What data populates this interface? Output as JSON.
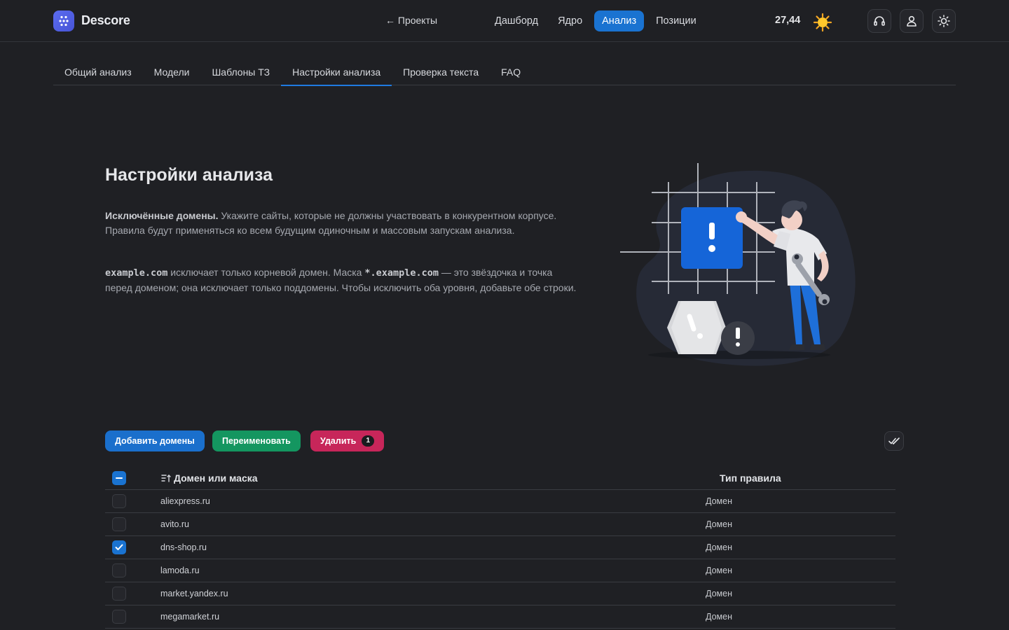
{
  "app": {
    "name": "Descore"
  },
  "header": {
    "back_label": "← Проекты",
    "nav": [
      {
        "label": "Дашборд",
        "active": false
      },
      {
        "label": "Ядро",
        "active": false
      },
      {
        "label": "Анализ",
        "active": true
      },
      {
        "label": "Позиции",
        "active": false
      }
    ],
    "balance": "27,44",
    "icons": [
      "sun-emoji-icon",
      "headset-icon",
      "user-icon",
      "theme-toggle-icon"
    ]
  },
  "subtabs": [
    {
      "label": "Общий анализ",
      "active": false
    },
    {
      "label": "Модели",
      "active": false
    },
    {
      "label": "Шаблоны ТЗ",
      "active": false
    },
    {
      "label": "Настройки анализа",
      "active": true
    },
    {
      "label": "Проверка текста",
      "active": false
    },
    {
      "label": "FAQ",
      "active": false
    }
  ],
  "intro": {
    "title": "Настройки анализа",
    "p1_strong": "Исключённые домены.",
    "p1_text": " Укажите сайты, которые не должны участвовать в конкурентном корпусе. Правила будут применяться ко всем будущим одиночным и массовым запускам анализа.",
    "p2_code1": "example.com",
    "p2_text1": " исключает только корневой домен. Маска ",
    "p2_code2": "*.example.com",
    "p2_text2": " — это звёздочка и точка перед доменом; она исключает только поддомены. Чтобы исключить оба уровня, добавьте обе строки."
  },
  "actions": {
    "add_label": "Добавить домены",
    "rename_label": "Переименовать",
    "delete_label": "Удалить",
    "delete_count": "1"
  },
  "table": {
    "col_domain": "Домен или маска",
    "col_type": "Тип правила",
    "rows": [
      {
        "domain": "aliexpress.ru",
        "type": "Домен",
        "checked": false
      },
      {
        "domain": "avito.ru",
        "type": "Домен",
        "checked": false
      },
      {
        "domain": "dns-shop.ru",
        "type": "Домен",
        "checked": true
      },
      {
        "domain": "lamoda.ru",
        "type": "Домен",
        "checked": false
      },
      {
        "domain": "market.yandex.ru",
        "type": "Домен",
        "checked": false
      },
      {
        "domain": "megamarket.ru",
        "type": "Домен",
        "checked": false
      }
    ]
  },
  "colors": {
    "background": "#1f2024",
    "accent": "#1a73d1",
    "rename": "#149660",
    "delete": "#c7265a"
  }
}
